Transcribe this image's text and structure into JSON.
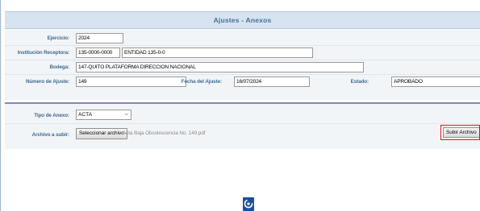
{
  "header": {
    "title": "Ajustes - Anexos"
  },
  "form": {
    "ejercicio": {
      "label": "Ejercicio:",
      "value": "2024"
    },
    "institucion": {
      "label": "Institución Receptora:",
      "code": "135-0000-0000",
      "name": "ENTIDAD 135-0-0"
    },
    "bodega": {
      "label": "Bodega:",
      "value": "147-QUITO PLATAFORMA DIRECCION NACIONAL"
    },
    "numero": {
      "label": "Número de Ajuste:",
      "value": "149"
    },
    "fecha": {
      "label": "Fecha del Ajuste:",
      "value": "16/07/2024"
    },
    "estado": {
      "label": "Estado:",
      "value": "APROBADO"
    }
  },
  "anexo": {
    "tipo": {
      "label": "Tipo de Anexo:",
      "value": "ACTA"
    },
    "archivo": {
      "label": "Archivo a subir:",
      "button_label": "Seleccionar archivo",
      "filename": "Acta Baja Obsolescencia No. 149.pdf"
    },
    "upload_label": "Subir Archivo"
  },
  "icons": {
    "loader": "loading-spinner-icon"
  },
  "colors": {
    "header_bg": "#d6e3f0",
    "label": "#3f6993",
    "divider": "#7f87b9",
    "highlight": "#d0191f"
  }
}
